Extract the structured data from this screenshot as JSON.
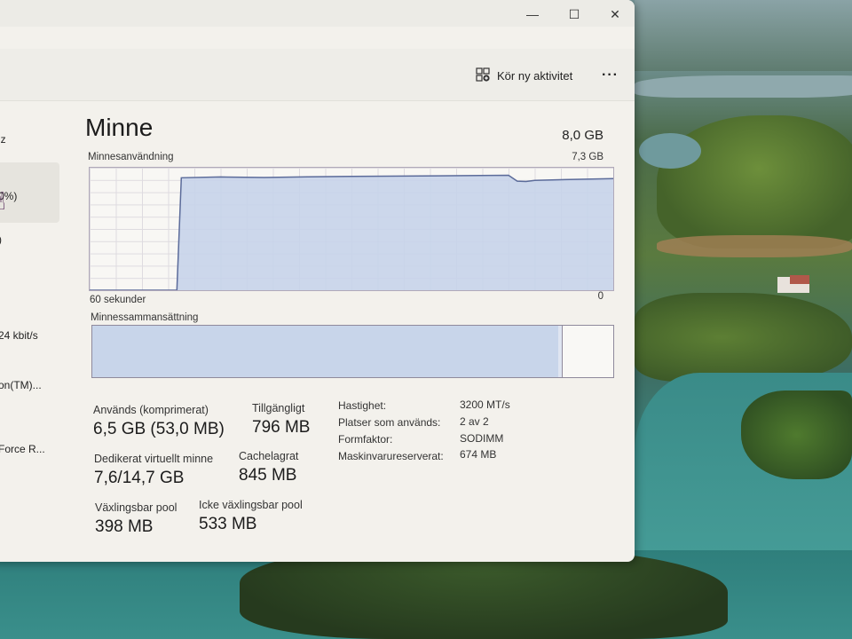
{
  "window": {
    "minimize_glyph": "—",
    "maximize_glyph": "☐",
    "close_glyph": "✕"
  },
  "toolbar": {
    "run_new_task_label": "Kör ny aktivitet",
    "more_glyph": "···"
  },
  "sidebar_fragments": [
    "lz",
    "0%)",
    ")",
    "24 kbit/s",
    "on(TM)...",
    "Force R..."
  ],
  "memory": {
    "title": "Minne",
    "total": "8,0 GB",
    "usage_label": "Minnesanvändning",
    "usage_max": "7,3 GB",
    "time_left_label": "60 sekunder",
    "time_right_label": "0",
    "composition_label": "Minnessammansättning",
    "stats": {
      "in_use": {
        "label": "Används (komprimerat)",
        "value": "6,5 GB (53,0 MB)"
      },
      "available": {
        "label": "Tillgängligt",
        "value": "796 MB"
      },
      "committed": {
        "label": "Dedikerat virtuellt minne",
        "value": "7,6/14,7 GB"
      },
      "cached": {
        "label": "Cachelagrat",
        "value": "845 MB"
      },
      "paged_pool": {
        "label": "Växlingsbar pool",
        "value": "398 MB"
      },
      "nonpaged_pool": {
        "label": "Icke växlingsbar pool",
        "value": "533 MB"
      }
    },
    "details": [
      {
        "label": "Hastighet:",
        "value": "3200 MT/s"
      },
      {
        "label": "Platser som används:",
        "value": "2 av 2"
      },
      {
        "label": "Formfaktor:",
        "value": "SODIMM"
      },
      {
        "label": "Maskinvarureserverat:",
        "value": "674 MB"
      }
    ]
  },
  "colors": {
    "graph_fill": "#c6d3ea",
    "graph_line": "#5b6b9a",
    "accent": "#6d7aa0"
  },
  "chart_data": {
    "type": "area",
    "title": "Minnesanvändning",
    "x": [
      60,
      50,
      49.5,
      45,
      40,
      35,
      30,
      20,
      12,
      11,
      10,
      9,
      5,
      0
    ],
    "values": [
      0,
      0,
      6.7,
      6.75,
      6.72,
      6.76,
      6.78,
      6.82,
      6.85,
      6.5,
      6.48,
      6.55,
      6.6,
      6.65
    ],
    "xlabel": "60 sekunder",
    "ylabel": "",
    "xlim": [
      60,
      0
    ],
    "ylim": [
      0,
      7.3
    ],
    "composition_in_use_fraction": 0.895,
    "composition_modified_fraction": 0.007
  }
}
